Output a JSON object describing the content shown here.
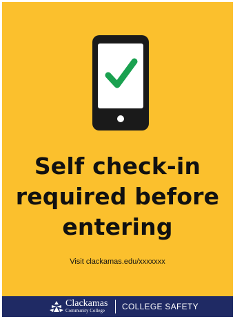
{
  "poster": {
    "background_color": "#fbc02d",
    "icon": "smartphone-checkmark-icon",
    "headline_lines": [
      "Self check-in",
      "required before",
      "entering"
    ],
    "visit_text": "Visit clackamas.edu/xxxxxxx"
  },
  "footer": {
    "background_color": "#1f2a64",
    "logo_icon": "clackamas-logo-mark-icon",
    "logo_name": "Clackamas",
    "logo_subtitle": "Community College",
    "department": "COLLEGE SAFETY"
  },
  "colors": {
    "check_green": "#1aa150",
    "phone_body": "#1a1a1a",
    "screen": "#ffffff"
  }
}
